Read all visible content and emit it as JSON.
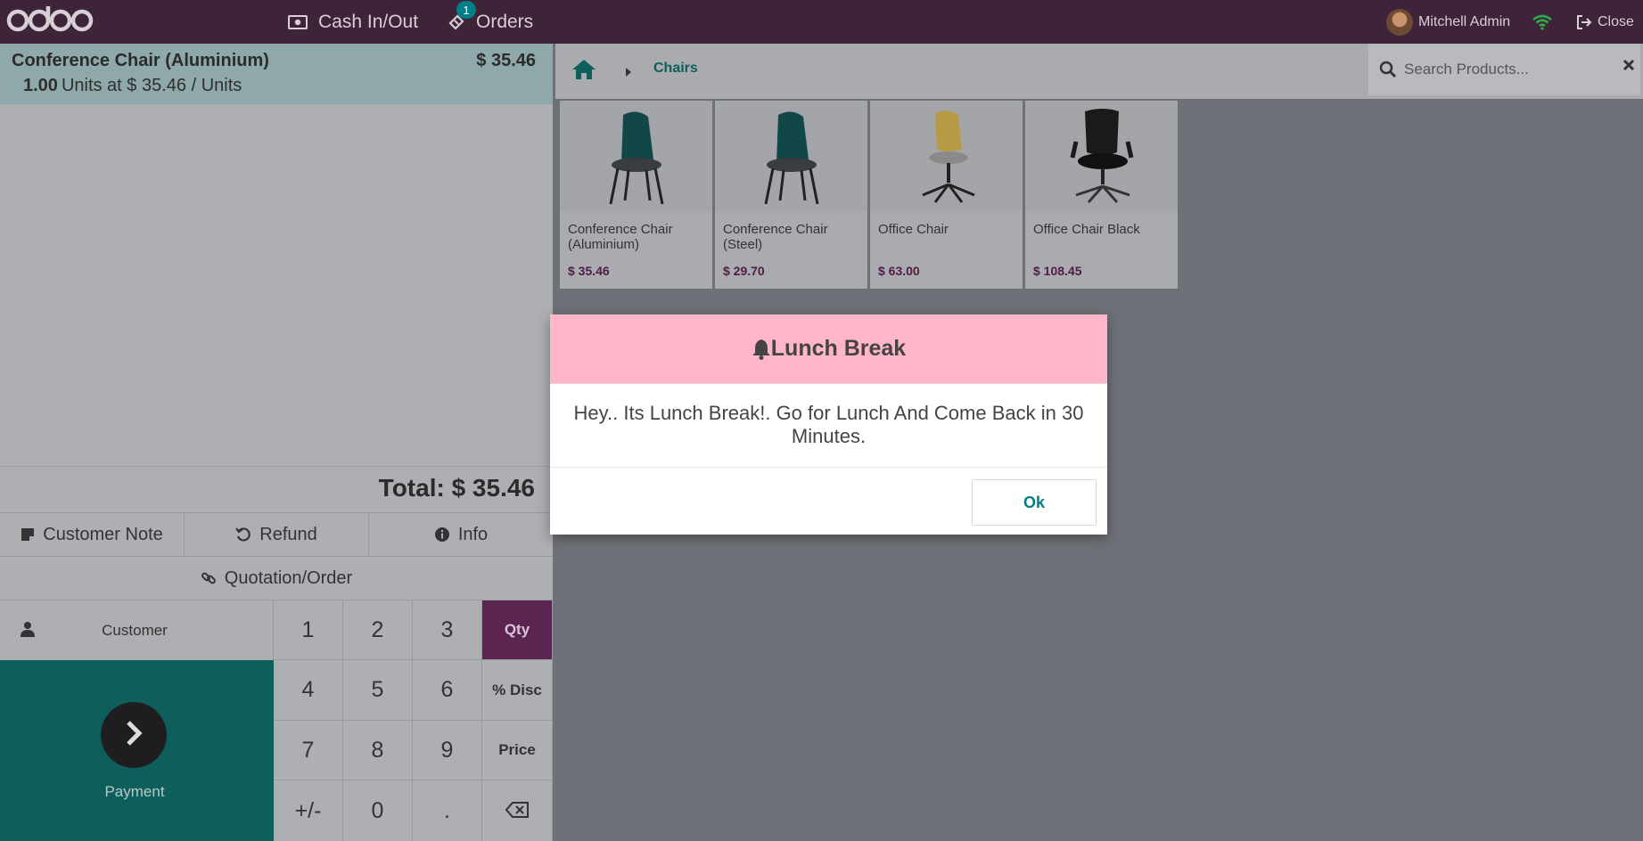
{
  "topbar": {
    "logo": "odoo",
    "cash_label": "Cash In/Out",
    "orders_label": "Orders",
    "orders_badge": "1",
    "user_name": "Mitchell Admin",
    "close_label": "Close"
  },
  "order": {
    "line": {
      "name": "Conference Chair (Aluminium)",
      "price": "$ 35.46",
      "qty": "1.00",
      "unit_text": "Units at $ 35.46 / Units"
    },
    "total": "Total: $ 35.46"
  },
  "controls": {
    "customer_note": "Customer Note",
    "refund": "Refund",
    "info": "Info",
    "quotation": "Quotation/Order"
  },
  "pad": {
    "customer": "Customer",
    "payment": "Payment",
    "keys": {
      "k1": "1",
      "k2": "2",
      "k3": "3",
      "qty": "Qty",
      "k4": "4",
      "k5": "5",
      "k6": "6",
      "disc": "% Disc",
      "k7": "7",
      "k8": "8",
      "k9": "9",
      "price": "Price",
      "sign": "+/-",
      "k0": "0",
      "dot": "."
    },
    "active_mode": "Qty"
  },
  "breadcrumb": {
    "category": "Chairs"
  },
  "search": {
    "placeholder": "Search Products..."
  },
  "products": [
    {
      "name": "Conference Chair (Aluminium)",
      "price": "$ 35.46"
    },
    {
      "name": "Conference Chair (Steel)",
      "price": "$ 29.70"
    },
    {
      "name": "Office Chair",
      "price": "$ 63.00"
    },
    {
      "name": "Office Chair Black",
      "price": "$ 108.45"
    }
  ],
  "dialog": {
    "title": "Lunch Break",
    "message": "Hey.. Its Lunch Break!. Go for Lunch And Come Back in 30 Minutes.",
    "ok_label": "Ok"
  },
  "colors": {
    "topbar": "#3e2439",
    "accent_teal": "#017e84",
    "payment_bg": "#0e5e5c",
    "qty_active": "#5b2451",
    "dialog_header": "#ffb6c9"
  }
}
